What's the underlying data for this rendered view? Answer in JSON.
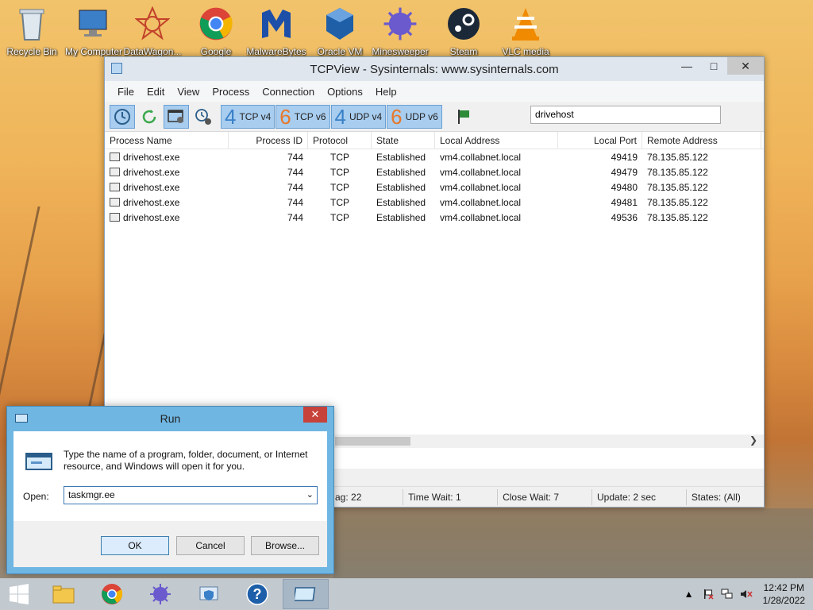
{
  "desktop": {
    "icons": [
      {
        "label": "Recycle Bin",
        "icon": "recycle-bin-icon"
      },
      {
        "label": "My Computer",
        "icon": "computer-icon"
      },
      {
        "label": "DataWagon...",
        "icon": "datawagon-icon"
      },
      {
        "label": "Google",
        "icon": "chrome-icon"
      },
      {
        "label": "MalwareBytes",
        "icon": "malwarebytes-icon"
      },
      {
        "label": "Oracle VM",
        "icon": "virtualbox-icon"
      },
      {
        "label": "Minesweeper",
        "icon": "mine-icon"
      },
      {
        "label": "Steam",
        "icon": "steam-icon"
      },
      {
        "label": "VLC media",
        "icon": "vlc-icon"
      }
    ]
  },
  "tcpview": {
    "title": "TCPView - Sysinternals: www.sysinternals.com",
    "menu": [
      "File",
      "Edit",
      "View",
      "Process",
      "Connection",
      "Options",
      "Help"
    ],
    "toolbar": {
      "protocols": [
        {
          "num": "4",
          "label": "TCP v4",
          "color": "blue"
        },
        {
          "num": "6",
          "label": "TCP v6",
          "color": "orange"
        },
        {
          "num": "4",
          "label": "UDP v4",
          "color": "blue"
        },
        {
          "num": "6",
          "label": "UDP v6",
          "color": "orange"
        }
      ]
    },
    "filter_value": "drivehost",
    "columns": [
      "Process Name",
      "Process ID",
      "Protocol",
      "State",
      "Local Address",
      "Local Port",
      "Remote Address"
    ],
    "rows": [
      [
        "drivehost.exe",
        "744",
        "TCP",
        "Established",
        "vm4.collabnet.local",
        "49419",
        "78.135.85.122"
      ],
      [
        "drivehost.exe",
        "744",
        "TCP",
        "Established",
        "vm4.collabnet.local",
        "49479",
        "78.135.85.122"
      ],
      [
        "drivehost.exe",
        "744",
        "TCP",
        "Established",
        "vm4.collabnet.local",
        "49480",
        "78.135.85.122"
      ],
      [
        "drivehost.exe",
        "744",
        "TCP",
        "Established",
        "vm4.collabnet.local",
        "49481",
        "78.135.85.122"
      ],
      [
        "drivehost.exe",
        "744",
        "TCP",
        "Established",
        "vm4.collabnet.local",
        "49536",
        "78.135.85.122"
      ]
    ],
    "status": [
      "ag: 22",
      "Time Wait: 1",
      "Close Wait: 7",
      "Update: 2 sec",
      "States: (All)"
    ]
  },
  "run": {
    "title": "Run",
    "message": "Type the name of a program, folder, document, or Internet resource, and Windows will open it for you.",
    "open_label": "Open:",
    "open_value": "taskmgr.ee",
    "ok": "OK",
    "cancel": "Cancel",
    "browse": "Browse..."
  },
  "taskbar": {
    "time": "12:42 PM",
    "date": "1/28/2022"
  },
  "colors": {
    "accent": "#a8cdef",
    "run_frame": "#6fb6e2",
    "close_red": "#c7423a"
  }
}
